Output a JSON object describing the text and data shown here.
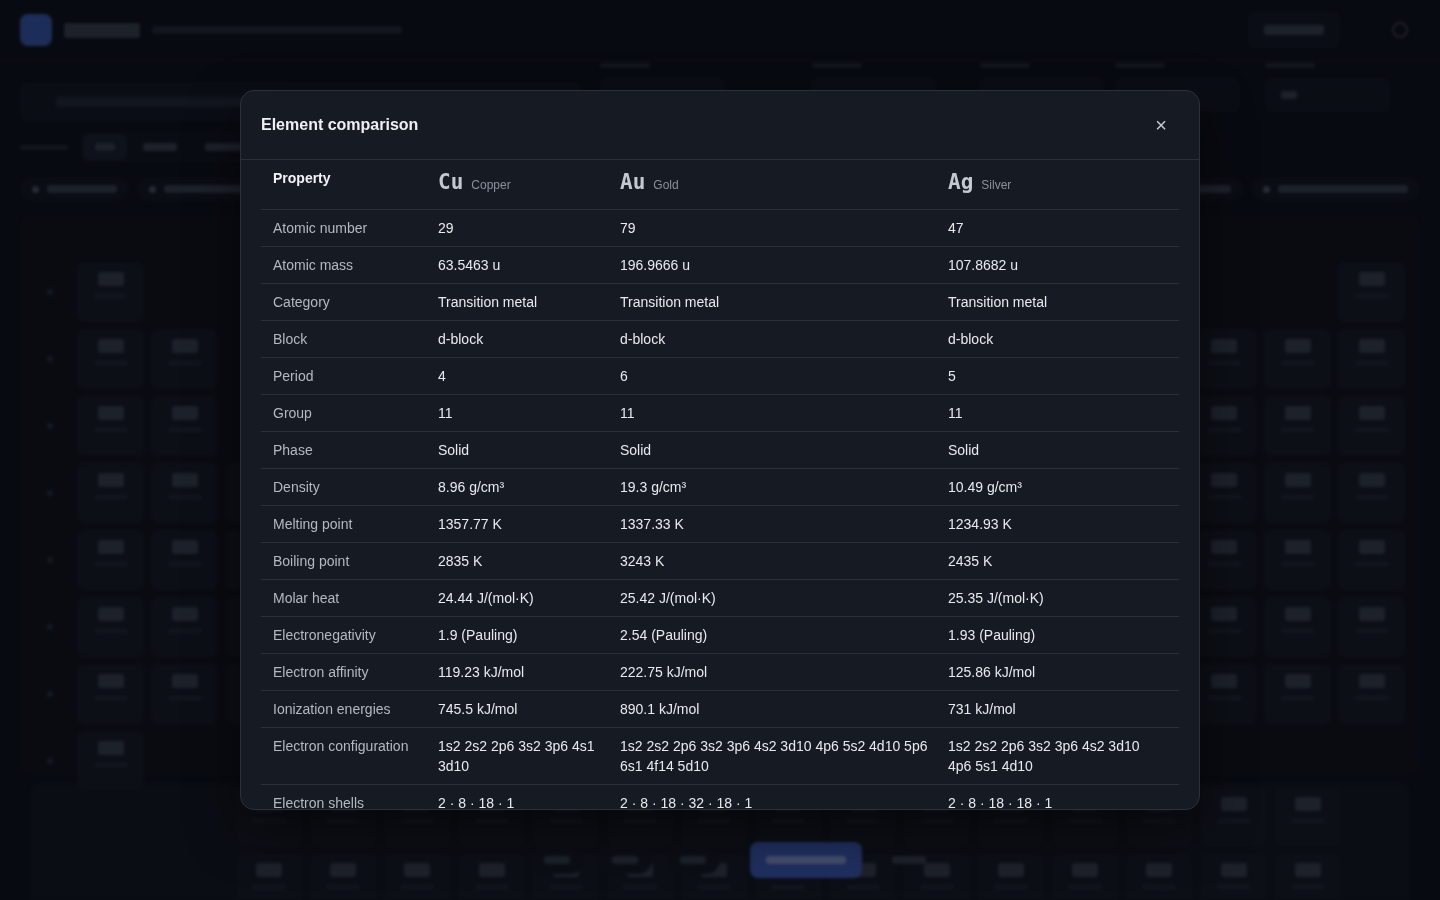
{
  "modal": {
    "title": "Element comparison",
    "close": "×",
    "property_heading": "Property",
    "elements": [
      {
        "symbol": "Cu",
        "name": "Copper"
      },
      {
        "symbol": "Au",
        "name": "Gold"
      },
      {
        "symbol": "Ag",
        "name": "Silver"
      }
    ],
    "rows": [
      {
        "property": "Atomic number",
        "values": [
          "29",
          "79",
          "47"
        ]
      },
      {
        "property": "Atomic mass",
        "values": [
          "63.5463 u",
          "196.9666 u",
          "107.8682 u"
        ]
      },
      {
        "property": "Category",
        "values": [
          "Transition metal",
          "Transition metal",
          "Transition metal"
        ]
      },
      {
        "property": "Block",
        "values": [
          "d-block",
          "d-block",
          "d-block"
        ]
      },
      {
        "property": "Period",
        "values": [
          "4",
          "6",
          "5"
        ]
      },
      {
        "property": "Group",
        "values": [
          "11",
          "11",
          "11"
        ]
      },
      {
        "property": "Phase",
        "values": [
          "Solid",
          "Solid",
          "Solid"
        ]
      },
      {
        "property": "Density",
        "values": [
          "8.96 g/cm³",
          "19.3 g/cm³",
          "10.49 g/cm³"
        ]
      },
      {
        "property": "Melting point",
        "values": [
          "1357.77 K",
          "1337.33 K",
          "1234.93 K"
        ]
      },
      {
        "property": "Boiling point",
        "values": [
          "2835 K",
          "3243 K",
          "2435 K"
        ]
      },
      {
        "property": "Molar heat",
        "values": [
          "24.44 J/(mol·K)",
          "25.42 J/(mol·K)",
          "25.35 J/(mol·K)"
        ]
      },
      {
        "property": "Electronegativity",
        "values": [
          "1.9 (Pauling)",
          "2.54 (Pauling)",
          "1.93 (Pauling)"
        ]
      },
      {
        "property": "Electron affinity",
        "values": [
          "119.23 kJ/mol",
          "222.75 kJ/mol",
          "125.86 kJ/mol"
        ]
      },
      {
        "property": "Ionization energies",
        "values": [
          "745.5 kJ/mol",
          "890.1 kJ/mol",
          "731 kJ/mol"
        ]
      },
      {
        "property": "Electron configuration",
        "values": [
          "1s2 2s2 2p6 3s2 3p6 4s1 3d10",
          "1s2 2s2 2p6 3s2 3p6 4s2 3d10 4p6 5s2 4d10 5p6 6s1 4f14 5d10",
          "1s2 2s2 2p6 3s2 3p6 4s2 3d10 4p6 5s1 4d10"
        ]
      },
      {
        "property": "Electron shells",
        "values": [
          "2 · 8 · 18 · 1",
          "2 · 8 · 18 · 32 · 18 · 1",
          "2 · 8 · 18 · 18 · 1"
        ]
      }
    ]
  }
}
